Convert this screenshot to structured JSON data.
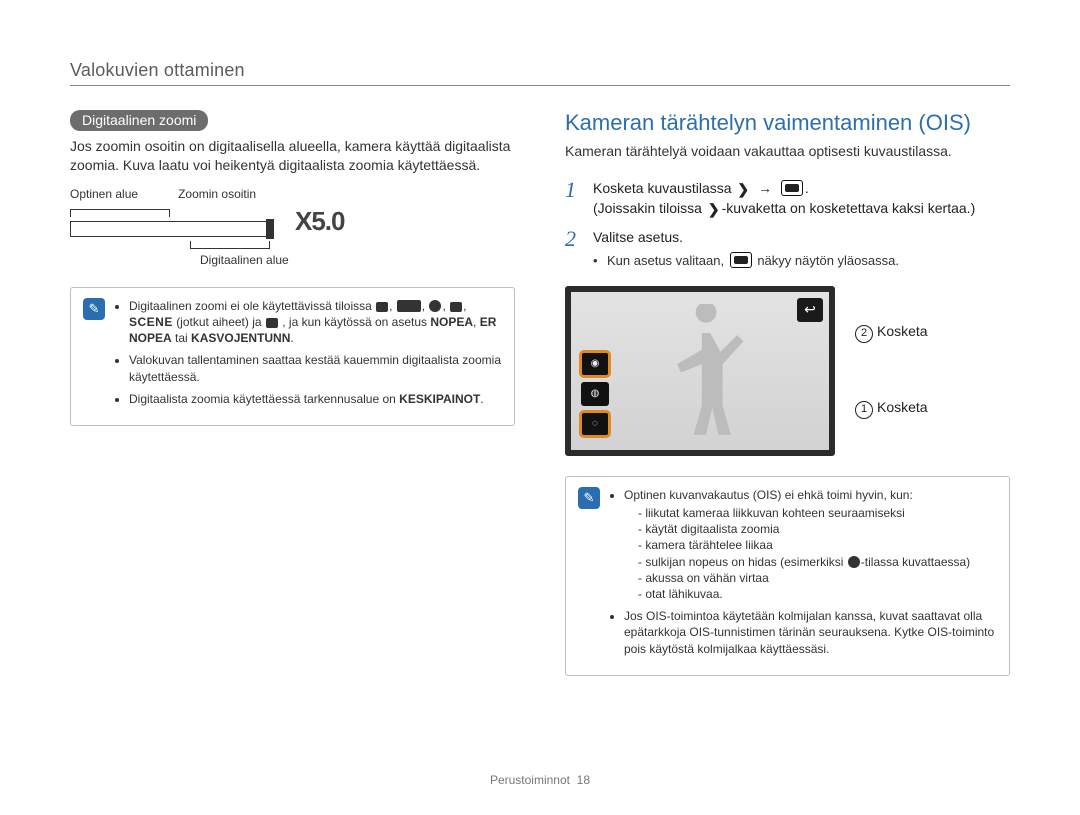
{
  "header": {
    "title": "Valokuvien ottaminen"
  },
  "left": {
    "pill": "Digitaalinen zoomi",
    "intro": "Jos zoomin osoitin on digitaalisella alueella, kamera käyttää digitaalista zoomia. Kuva laatu voi heikentyä digitaalista zoomia käytettäessä.",
    "labels": {
      "optical": "Optinen alue",
      "indicator": "Zoomin osoitin",
      "digital": "Digitaalinen alue"
    },
    "zoom_level": "X5.0",
    "notes": {
      "item1_prefix": "Digitaalinen zoomi ei ole käytettävissä tiloissa ",
      "item1_mid": " (jotkut aiheet) ja ",
      "item1_suffix": ", ja kun käytössä on asetus ",
      "bold1": "NOPEA",
      "bold2": "ER NOPEA",
      "or": " tai ",
      "bold3": "KASVOJENTUNN",
      "item2": "Valokuvan tallentaminen saattaa kestää kauemmin digitaalista zoomia käytettäessä.",
      "item3_prefix": "Digitaalista zoomia käytettäessä tarkennusalue on ",
      "item3_bold": "KESKIPAINOT",
      "period": "."
    }
  },
  "right": {
    "heading": "Kameran tärähtelyn vaimentaminen (OIS)",
    "lead": "Kameran tärähtelyä voidaan vakauttaa optisesti kuvaustilassa.",
    "steps": {
      "s1": {
        "line1_prefix": "Kosketa kuvaustilassa ",
        "line2": "(Joissakin tiloissa ",
        "line2_suffix": "-kuvaketta on kosketettava kaksi kertaa.)"
      },
      "s2": {
        "text": "Valitse asetus.",
        "sub_prefix": "Kun asetus valitaan, ",
        "sub_suffix": " näkyy näytön yläosassa."
      }
    },
    "callouts": {
      "c2": "Kosketa",
      "c1": "Kosketa"
    },
    "notes": {
      "lead": "Optinen kuvanvakautus (OIS) ei ehkä toimi hyvin, kun:",
      "d1": "liikutat kameraa liikkuvan kohteen seuraamiseksi",
      "d2": "käytät digitaalista zoomia",
      "d3": "kamera tärähtelee liikaa",
      "d4_prefix": "sulkijan nopeus on hidas (esimerkiksi ",
      "d4_suffix": "-tilassa kuvattaessa)",
      "d5": "akussa on vähän virtaa",
      "d6": "otat lähikuvaa.",
      "tripod": "Jos OIS-toimintoa käytetään kolmijalan kanssa, kuvat saattavat olla epätarkkoja OIS-tunnistimen tärinän seurauksena. Kytke OIS-toiminto pois käytöstä kolmijalkaa käyttäessäsi."
    }
  },
  "footer": {
    "section": "Perustoiminnot",
    "page": "18"
  }
}
